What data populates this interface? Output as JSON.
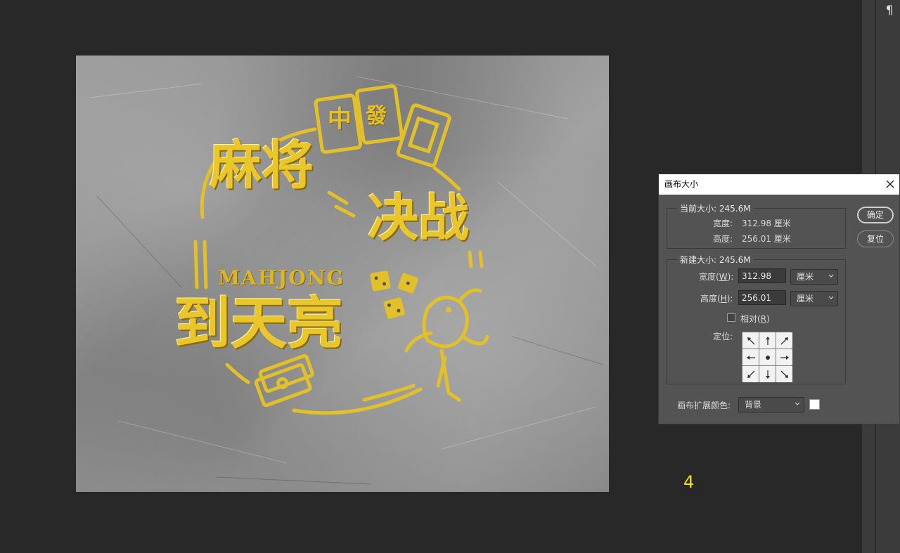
{
  "document": {
    "headline_top": "麻将",
    "headline_right": "决战",
    "subtitle_en": "MAHJONG",
    "headline_bottom": "到天亮",
    "tile_chars": [
      "中",
      "發"
    ],
    "gold_color": "#e2c02a"
  },
  "dialog": {
    "title": "画布大小",
    "current_size": {
      "label": "当前大小: 245.6M",
      "width_label": "宽度:",
      "width_value": "312.98 厘米",
      "height_label": "高度:",
      "height_value": "256.01 厘米"
    },
    "new_size": {
      "label": "新建大小: 245.6M",
      "width_label_prefix": "宽度(",
      "width_label_key": "W",
      "width_label_suffix": "):",
      "width_value": "312.98",
      "width_unit": "厘米",
      "height_label_prefix": "高度(",
      "height_label_key": "H",
      "height_label_suffix": "):",
      "height_value": "256.01",
      "height_unit": "厘米",
      "relative_label_prefix": "相对(",
      "relative_label_key": "R",
      "relative_label_suffix": ")",
      "relative_checked": false,
      "anchor_label": "定位:"
    },
    "extension": {
      "label": "画布扩展颜色:",
      "value": "背景",
      "swatch_color": "#ffffff"
    },
    "buttons": {
      "ok": "确定",
      "reset": "复位"
    }
  },
  "right_panel": {
    "icon": "paragraph-icon",
    "glyph": "¶"
  },
  "overlay": {
    "page_number": "4"
  }
}
